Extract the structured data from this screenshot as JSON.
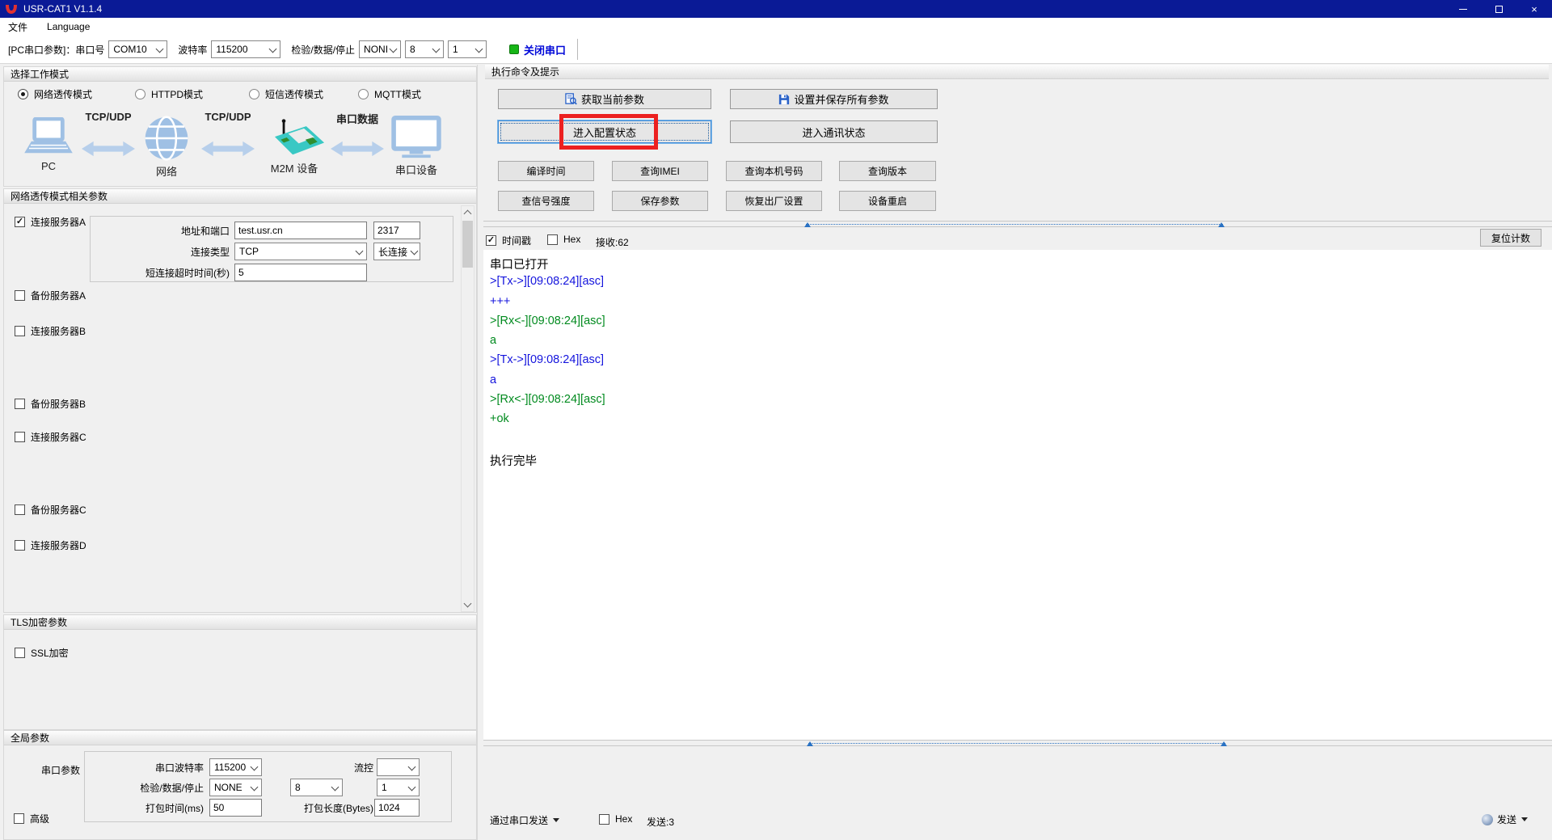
{
  "window": {
    "title": "USR-CAT1 V1.1.4"
  },
  "menu": {
    "items": [
      "文件",
      "Language"
    ]
  },
  "toolbar": {
    "pc_param_label": "[PC串口参数]：串口号",
    "com_port": "COM10",
    "baud_label": "波特率",
    "baud": "115200",
    "parity_label": "检验/数据/停止",
    "parity": "NONI",
    "databits": "8",
    "stopbits": "1",
    "close_port": "关闭串口"
  },
  "work_mode": {
    "header": "选择工作模式",
    "options": [
      {
        "label": "网络透传模式",
        "selected": true
      },
      {
        "label": "HTTPD模式",
        "selected": false
      },
      {
        "label": "短信透传模式",
        "selected": false
      },
      {
        "label": "MQTT模式",
        "selected": false
      }
    ],
    "diagram": {
      "nodes": [
        "PC",
        "网络",
        "M2M 设备",
        "串口设备"
      ],
      "links": [
        "TCP/UDP",
        "TCP/UDP",
        "串口数据"
      ]
    }
  },
  "net_params": {
    "header": "网络透传模式相关参数",
    "server_a": {
      "label": "连接服务器A",
      "addr_label": "地址和端口",
      "addr": "test.usr.cn",
      "port": "2317",
      "conn_type_label": "连接类型",
      "conn_type": "TCP",
      "keep_type": "长连接",
      "timeout_label": "短连接超时时间(秒)",
      "timeout": "5"
    },
    "checkboxes": [
      "备份服务器A",
      "连接服务器B",
      "备份服务器B",
      "连接服务器C",
      "备份服务器C",
      "连接服务器D"
    ]
  },
  "tls": {
    "header": "TLS加密参数",
    "ssl_label": "SSL加密"
  },
  "global_params": {
    "header": "全局参数",
    "serial_label": "串口参数",
    "baud_label": "串口波特率",
    "baud": "115200",
    "flow_label": "流控",
    "flow": "",
    "parity_label": "检验/数据/停止",
    "parity": "NONE",
    "databits": "8",
    "stopbits": "1",
    "pack_time_label": "打包时间(ms)",
    "pack_time": "50",
    "pack_len_label": "打包长度(Bytes)",
    "pack_len": "1024",
    "advanced_label": "高级"
  },
  "commands": {
    "header": "执行命令及提示",
    "get_params": "获取当前参数",
    "set_save_params": "设置并保存所有参数",
    "enter_config": "进入配置状态",
    "enter_comm": "进入通讯状态",
    "small_buttons": [
      "编译时间",
      "查询IMEI",
      "查询本机号码",
      "查询版本",
      "查信号强度",
      "保存参数",
      "恢复出厂设置",
      "设备重启"
    ]
  },
  "log": {
    "timestamp_label": "时间戳",
    "hex_label": "Hex",
    "recv_label": "接收:62",
    "reset_count": "复位计数",
    "lines": [
      {
        "text": "串口已打开",
        "color": "plain"
      },
      {
        "text": ">[Tx->][09:08:24][asc]",
        "color": "tx"
      },
      {
        "text": "+++",
        "color": "tx"
      },
      {
        "text": ">[Rx<-][09:08:24][asc]",
        "color": "rx"
      },
      {
        "text": "a",
        "color": "rx"
      },
      {
        "text": ">[Tx->][09:08:24][asc]",
        "color": "tx"
      },
      {
        "text": "a",
        "color": "tx"
      },
      {
        "text": ">[Rx<-][09:08:24][asc]",
        "color": "rx"
      },
      {
        "text": "+ok",
        "color": "rx"
      },
      {
        "text": "",
        "color": "plain"
      },
      {
        "text": "执行完毕",
        "color": "plain"
      }
    ]
  },
  "send": {
    "via_label": "通过串口发送",
    "hex_label": "Hex",
    "sent_label": "发送:3",
    "send_label": "发送"
  },
  "colors": {
    "titlebar": "#0a1a96",
    "led_green": "#17b617",
    "close_port_text": "#0008d8",
    "tx_blue": "#1414dd",
    "rx_green": "#008a1e",
    "annotation_red": "#ec2020",
    "focus_blue": "#2a72c3",
    "diagram_blue": "#9fc0e4",
    "board_teal": "#39c8c4"
  }
}
